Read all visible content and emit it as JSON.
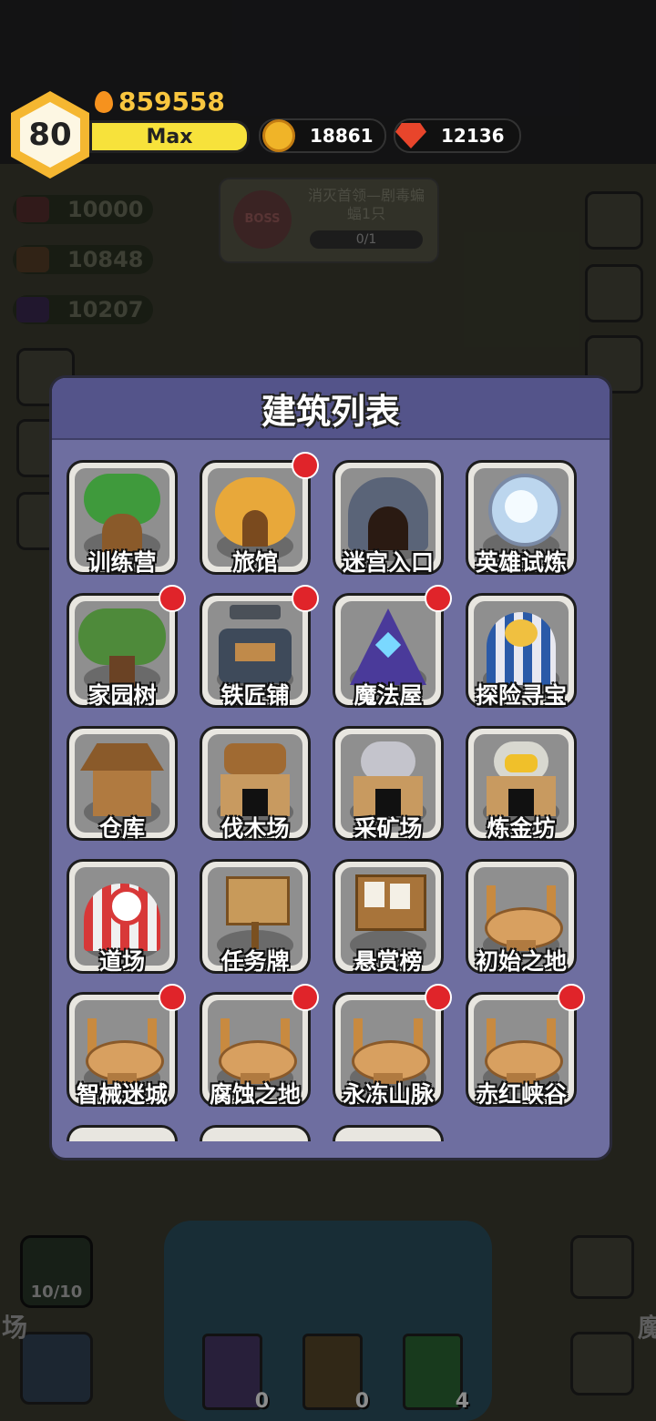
{
  "player": {
    "level": "80",
    "level_status": "Max",
    "power": "859558"
  },
  "currencies": {
    "coins": "18861",
    "gems": "12136"
  },
  "background": {
    "resources": [
      "10000",
      "10848",
      "10207"
    ],
    "quest": {
      "badge": "BOSS",
      "text": "消灭首领—剧毒蝙蝠1只",
      "progress": "0/1"
    },
    "slime_count": "10/10",
    "left_label": "场",
    "right_label": "魔",
    "books": [
      "0",
      "0",
      "4"
    ]
  },
  "modal": {
    "title": "建筑列表",
    "buildings": [
      {
        "label": "训练营",
        "icon": "tree-house-icon",
        "badge": false
      },
      {
        "label": "旅馆",
        "icon": "pumpkin-house-icon",
        "badge": true
      },
      {
        "label": "迷宫入口",
        "icon": "cave-entrance-icon",
        "badge": false
      },
      {
        "label": "英雄试炼",
        "icon": "portal-icon",
        "badge": false
      },
      {
        "label": "家园树",
        "icon": "big-tree-icon",
        "badge": true
      },
      {
        "label": "铁匠铺",
        "icon": "anvil-shop-icon",
        "badge": true
      },
      {
        "label": "魔法屋",
        "icon": "magic-tent-icon",
        "badge": true
      },
      {
        "label": "探险寻宝",
        "icon": "treasure-tent-icon",
        "badge": false
      },
      {
        "label": "仓库",
        "icon": "warehouse-icon",
        "badge": false
      },
      {
        "label": "伐木场",
        "icon": "lumber-mill-icon",
        "badge": false
      },
      {
        "label": "采矿场",
        "icon": "mine-icon",
        "badge": false
      },
      {
        "label": "炼金坊",
        "icon": "alchemy-icon",
        "badge": false
      },
      {
        "label": "道场",
        "icon": "dojo-tent-icon",
        "badge": false
      },
      {
        "label": "任务牌",
        "icon": "quest-board-icon",
        "badge": false
      },
      {
        "label": "悬赏榜",
        "icon": "bounty-board-icon",
        "badge": false
      },
      {
        "label": "初始之地",
        "icon": "arena-icon",
        "badge": false
      },
      {
        "label": "智械迷城",
        "icon": "arena-icon",
        "badge": true
      },
      {
        "label": "腐蚀之地",
        "icon": "arena-icon",
        "badge": true
      },
      {
        "label": "永冻山脉",
        "icon": "arena-icon",
        "badge": true
      },
      {
        "label": "赤红峡谷",
        "icon": "arena-icon",
        "badge": true
      }
    ]
  },
  "colors": {
    "modal_bg": "#6e6ea0",
    "modal_header": "#54548a",
    "badge_red": "#e0242a",
    "xp_bar": "#f7e23b",
    "level_hex": "#f5b731"
  }
}
